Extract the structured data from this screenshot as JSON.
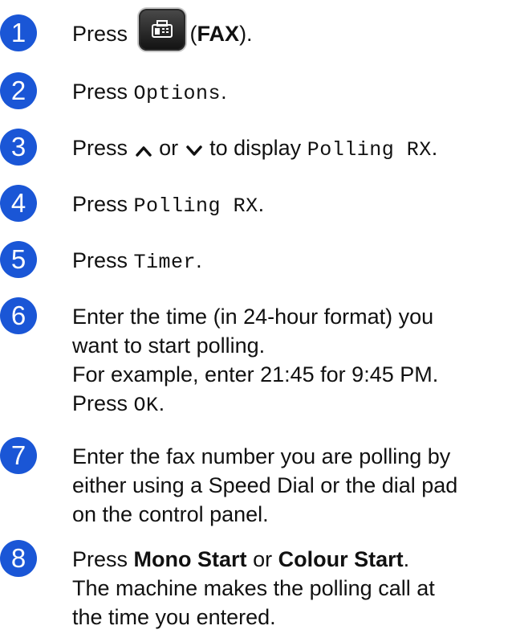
{
  "steps": [
    {
      "number": "1",
      "press": "Press",
      "fax_paren_open": "(",
      "fax_label": "FAX",
      "fax_paren_close": ")."
    },
    {
      "number": "2",
      "press": "Press",
      "menu": "Options",
      "end": "."
    },
    {
      "number": "3",
      "press": "Press",
      "or": "or",
      "to_display": "to display",
      "menu": "Polling RX",
      "end": "."
    },
    {
      "number": "4",
      "press": "Press",
      "menu": "Polling RX",
      "end": "."
    },
    {
      "number": "5",
      "press": "Press",
      "menu": "Timer",
      "end": "."
    },
    {
      "number": "6",
      "line1": "Enter the time (in 24-hour format) you",
      "line2": "want to start polling.",
      "line3": "For example, enter 21:45 for 9:45 PM.",
      "press": "Press",
      "menu": "OK",
      "end": "."
    },
    {
      "number": "7",
      "line1": "Enter the fax number you are polling by",
      "line2": "either using a Speed Dial or the dial pad",
      "line3": "on the control panel."
    },
    {
      "number": "8",
      "press": "Press",
      "mono_start": "Mono Start",
      "or": "or",
      "colour_start": "Colour Start",
      "end": ".",
      "line2": "The machine makes the polling call at",
      "line3": "the time you entered."
    }
  ],
  "icons": {
    "fax_button_icon": "fax-icon",
    "up_arrow": "chevron-up-icon",
    "down_arrow": "chevron-down-icon"
  },
  "colors": {
    "badge": "#1a56d6",
    "text": "#111111"
  }
}
